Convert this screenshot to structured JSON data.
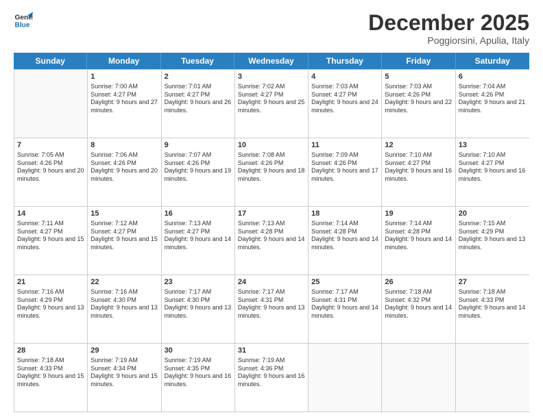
{
  "logo": {
    "line1": "General",
    "line2": "Blue"
  },
  "title": "December 2025",
  "location": "Poggiorsini, Apulia, Italy",
  "header_days": [
    "Sunday",
    "Monday",
    "Tuesday",
    "Wednesday",
    "Thursday",
    "Friday",
    "Saturday"
  ],
  "weeks": [
    [
      {
        "num": "",
        "sunrise": "",
        "sunset": "",
        "daylight": ""
      },
      {
        "num": "1",
        "sunrise": "Sunrise: 7:00 AM",
        "sunset": "Sunset: 4:27 PM",
        "daylight": "Daylight: 9 hours and 27 minutes."
      },
      {
        "num": "2",
        "sunrise": "Sunrise: 7:01 AM",
        "sunset": "Sunset: 4:27 PM",
        "daylight": "Daylight: 9 hours and 26 minutes."
      },
      {
        "num": "3",
        "sunrise": "Sunrise: 7:02 AM",
        "sunset": "Sunset: 4:27 PM",
        "daylight": "Daylight: 9 hours and 25 minutes."
      },
      {
        "num": "4",
        "sunrise": "Sunrise: 7:03 AM",
        "sunset": "Sunset: 4:27 PM",
        "daylight": "Daylight: 9 hours and 24 minutes."
      },
      {
        "num": "5",
        "sunrise": "Sunrise: 7:03 AM",
        "sunset": "Sunset: 4:26 PM",
        "daylight": "Daylight: 9 hours and 22 minutes."
      },
      {
        "num": "6",
        "sunrise": "Sunrise: 7:04 AM",
        "sunset": "Sunset: 4:26 PM",
        "daylight": "Daylight: 9 hours and 21 minutes."
      }
    ],
    [
      {
        "num": "7",
        "sunrise": "Sunrise: 7:05 AM",
        "sunset": "Sunset: 4:26 PM",
        "daylight": "Daylight: 9 hours and 20 minutes."
      },
      {
        "num": "8",
        "sunrise": "Sunrise: 7:06 AM",
        "sunset": "Sunset: 4:26 PM",
        "daylight": "Daylight: 9 hours and 20 minutes."
      },
      {
        "num": "9",
        "sunrise": "Sunrise: 7:07 AM",
        "sunset": "Sunset: 4:26 PM",
        "daylight": "Daylight: 9 hours and 19 minutes."
      },
      {
        "num": "10",
        "sunrise": "Sunrise: 7:08 AM",
        "sunset": "Sunset: 4:26 PM",
        "daylight": "Daylight: 9 hours and 18 minutes."
      },
      {
        "num": "11",
        "sunrise": "Sunrise: 7:09 AM",
        "sunset": "Sunset: 4:26 PM",
        "daylight": "Daylight: 9 hours and 17 minutes."
      },
      {
        "num": "12",
        "sunrise": "Sunrise: 7:10 AM",
        "sunset": "Sunset: 4:27 PM",
        "daylight": "Daylight: 9 hours and 16 minutes."
      },
      {
        "num": "13",
        "sunrise": "Sunrise: 7:10 AM",
        "sunset": "Sunset: 4:27 PM",
        "daylight": "Daylight: 9 hours and 16 minutes."
      }
    ],
    [
      {
        "num": "14",
        "sunrise": "Sunrise: 7:11 AM",
        "sunset": "Sunset: 4:27 PM",
        "daylight": "Daylight: 9 hours and 15 minutes."
      },
      {
        "num": "15",
        "sunrise": "Sunrise: 7:12 AM",
        "sunset": "Sunset: 4:27 PM",
        "daylight": "Daylight: 9 hours and 15 minutes."
      },
      {
        "num": "16",
        "sunrise": "Sunrise: 7:13 AM",
        "sunset": "Sunset: 4:27 PM",
        "daylight": "Daylight: 9 hours and 14 minutes."
      },
      {
        "num": "17",
        "sunrise": "Sunrise: 7:13 AM",
        "sunset": "Sunset: 4:28 PM",
        "daylight": "Daylight: 9 hours and 14 minutes."
      },
      {
        "num": "18",
        "sunrise": "Sunrise: 7:14 AM",
        "sunset": "Sunset: 4:28 PM",
        "daylight": "Daylight: 9 hours and 14 minutes."
      },
      {
        "num": "19",
        "sunrise": "Sunrise: 7:14 AM",
        "sunset": "Sunset: 4:28 PM",
        "daylight": "Daylight: 9 hours and 14 minutes."
      },
      {
        "num": "20",
        "sunrise": "Sunrise: 7:15 AM",
        "sunset": "Sunset: 4:29 PM",
        "daylight": "Daylight: 9 hours and 13 minutes."
      }
    ],
    [
      {
        "num": "21",
        "sunrise": "Sunrise: 7:16 AM",
        "sunset": "Sunset: 4:29 PM",
        "daylight": "Daylight: 9 hours and 13 minutes."
      },
      {
        "num": "22",
        "sunrise": "Sunrise: 7:16 AM",
        "sunset": "Sunset: 4:30 PM",
        "daylight": "Daylight: 9 hours and 13 minutes."
      },
      {
        "num": "23",
        "sunrise": "Sunrise: 7:17 AM",
        "sunset": "Sunset: 4:30 PM",
        "daylight": "Daylight: 9 hours and 13 minutes."
      },
      {
        "num": "24",
        "sunrise": "Sunrise: 7:17 AM",
        "sunset": "Sunset: 4:31 PM",
        "daylight": "Daylight: 9 hours and 13 minutes."
      },
      {
        "num": "25",
        "sunrise": "Sunrise: 7:17 AM",
        "sunset": "Sunset: 4:31 PM",
        "daylight": "Daylight: 9 hours and 14 minutes."
      },
      {
        "num": "26",
        "sunrise": "Sunrise: 7:18 AM",
        "sunset": "Sunset: 4:32 PM",
        "daylight": "Daylight: 9 hours and 14 minutes."
      },
      {
        "num": "27",
        "sunrise": "Sunrise: 7:18 AM",
        "sunset": "Sunset: 4:33 PM",
        "daylight": "Daylight: 9 hours and 14 minutes."
      }
    ],
    [
      {
        "num": "28",
        "sunrise": "Sunrise: 7:18 AM",
        "sunset": "Sunset: 4:33 PM",
        "daylight": "Daylight: 9 hours and 15 minutes."
      },
      {
        "num": "29",
        "sunrise": "Sunrise: 7:19 AM",
        "sunset": "Sunset: 4:34 PM",
        "daylight": "Daylight: 9 hours and 15 minutes."
      },
      {
        "num": "30",
        "sunrise": "Sunrise: 7:19 AM",
        "sunset": "Sunset: 4:35 PM",
        "daylight": "Daylight: 9 hours and 16 minutes."
      },
      {
        "num": "31",
        "sunrise": "Sunrise: 7:19 AM",
        "sunset": "Sunset: 4:36 PM",
        "daylight": "Daylight: 9 hours and 16 minutes."
      },
      {
        "num": "",
        "sunrise": "",
        "sunset": "",
        "daylight": ""
      },
      {
        "num": "",
        "sunrise": "",
        "sunset": "",
        "daylight": ""
      },
      {
        "num": "",
        "sunrise": "",
        "sunset": "",
        "daylight": ""
      }
    ]
  ]
}
